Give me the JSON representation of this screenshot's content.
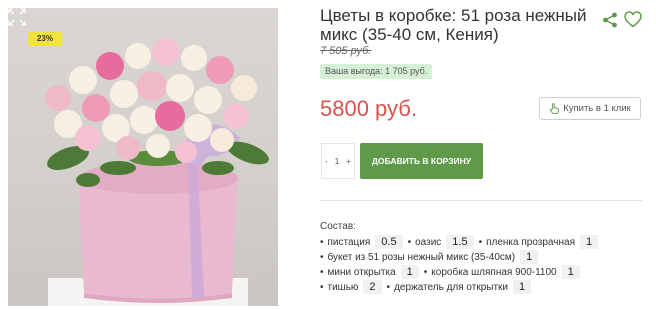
{
  "product": {
    "title": "Цветы в коробке: 51 роза нежный микс (35-40 см, Кения)",
    "discount_badge": "23%",
    "old_price": "7 505 руб.",
    "savings": "Ваша выгода: 1 705 руб.",
    "price": "5800 руб.",
    "one_click_label": "Купить в 1 клик"
  },
  "cart": {
    "minus": "-",
    "quantity": "1",
    "plus": "+",
    "add_label": "ДОБАВИТЬ В КОРЗИНУ"
  },
  "composition": {
    "title": "Состав:",
    "rows": [
      [
        {
          "name": "пистация",
          "qty": "0.5"
        },
        {
          "name": "оазис",
          "qty": "1.5"
        },
        {
          "name": "пленка прозрачная",
          "qty": "1"
        }
      ],
      [
        {
          "name": "букет из 51 розы нежный микс (35-40см)",
          "qty": "1"
        }
      ],
      [
        {
          "name": "мини открытка",
          "qty": "1"
        },
        {
          "name": "коробка шляпная 900-1100",
          "qty": "1"
        }
      ],
      [
        {
          "name": "тишью",
          "qty": "2"
        },
        {
          "name": "держатель для открытки",
          "qty": "1"
        }
      ]
    ]
  },
  "icons": {
    "expand": "expand-icon",
    "share": "share-icon",
    "favorite": "heart-icon",
    "one_click": "hand-pointer-icon"
  },
  "colors": {
    "accent_green": "#5e9a4a",
    "price_red": "#d9534f",
    "badge_yellow": "#f2e33a",
    "savings_bg": "#d6f0d6"
  }
}
